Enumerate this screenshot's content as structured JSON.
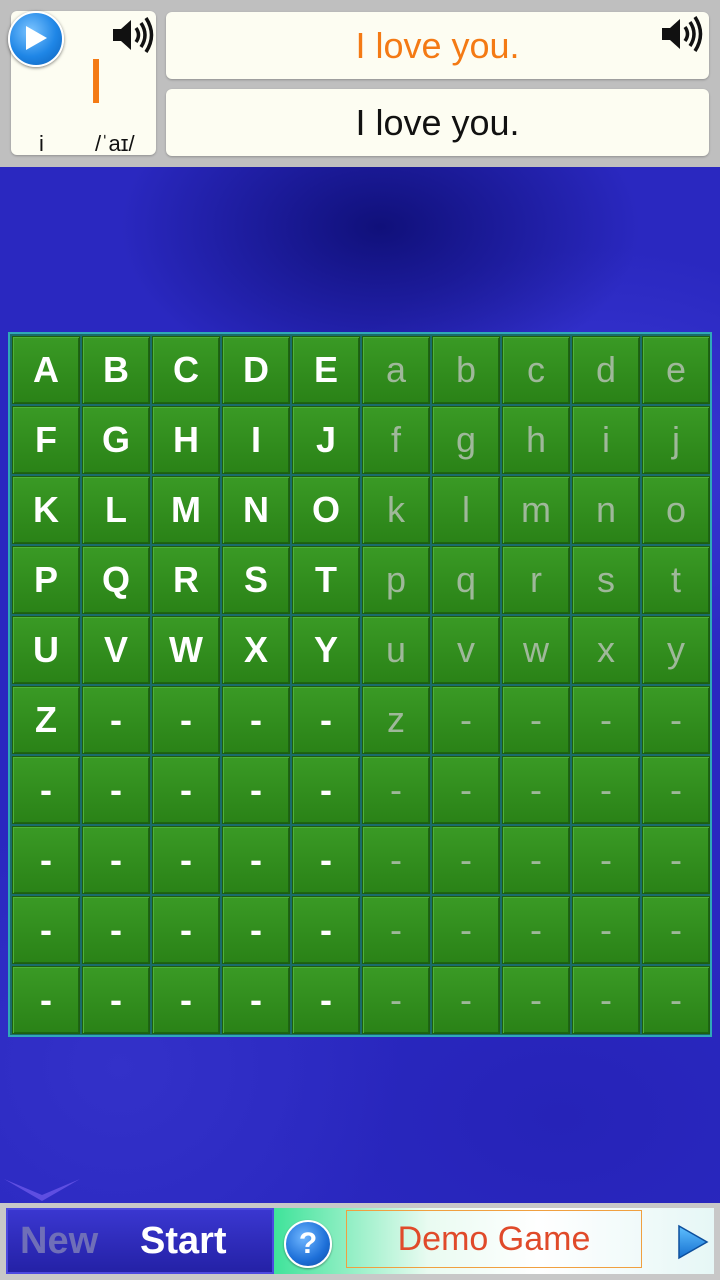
{
  "word_card": {
    "letter": "I",
    "letter_lower": "i",
    "phonetic": "/ˈaɪ/",
    "play_icon": "play-icon",
    "speaker_icon": "speaker-icon"
  },
  "sentences": {
    "highlighted": "I love you.",
    "plain": "I love you.",
    "speaker_icon": "speaker-icon"
  },
  "colors": {
    "accent_orange": "#f47a14",
    "tile_green": "#2a8217",
    "board_blue": "#2a28c0"
  },
  "grid": {
    "columns": 10,
    "rows": [
      [
        "A",
        "B",
        "C",
        "D",
        "E",
        "a",
        "b",
        "c",
        "d",
        "e"
      ],
      [
        "F",
        "G",
        "H",
        "I",
        "J",
        "f",
        "g",
        "h",
        "i",
        "j"
      ],
      [
        "K",
        "L",
        "M",
        "N",
        "O",
        "k",
        "l",
        "m",
        "n",
        "o"
      ],
      [
        "P",
        "Q",
        "R",
        "S",
        "T",
        "p",
        "q",
        "r",
        "s",
        "t"
      ],
      [
        "U",
        "V",
        "W",
        "X",
        "Y",
        "u",
        "v",
        "w",
        "x",
        "y"
      ],
      [
        "Z",
        "-",
        "-",
        "-",
        "-",
        "z",
        "-",
        "-",
        "-",
        "-"
      ],
      [
        "-",
        "-",
        "-",
        "-",
        "-",
        "-",
        "-",
        "-",
        "-",
        "-"
      ],
      [
        "-",
        "-",
        "-",
        "-",
        "-",
        "-",
        "-",
        "-",
        "-",
        "-"
      ],
      [
        "-",
        "-",
        "-",
        "-",
        "-",
        "-",
        "-",
        "-",
        "-",
        "-"
      ],
      [
        "-",
        "-",
        "-",
        "-",
        "-",
        "-",
        "-",
        "-",
        "-",
        "-"
      ]
    ]
  },
  "bottom": {
    "new_label": "New",
    "start_label": "Start",
    "help_label": "?",
    "demo_label": "Demo Game",
    "next_icon": "play-arrow-icon"
  }
}
